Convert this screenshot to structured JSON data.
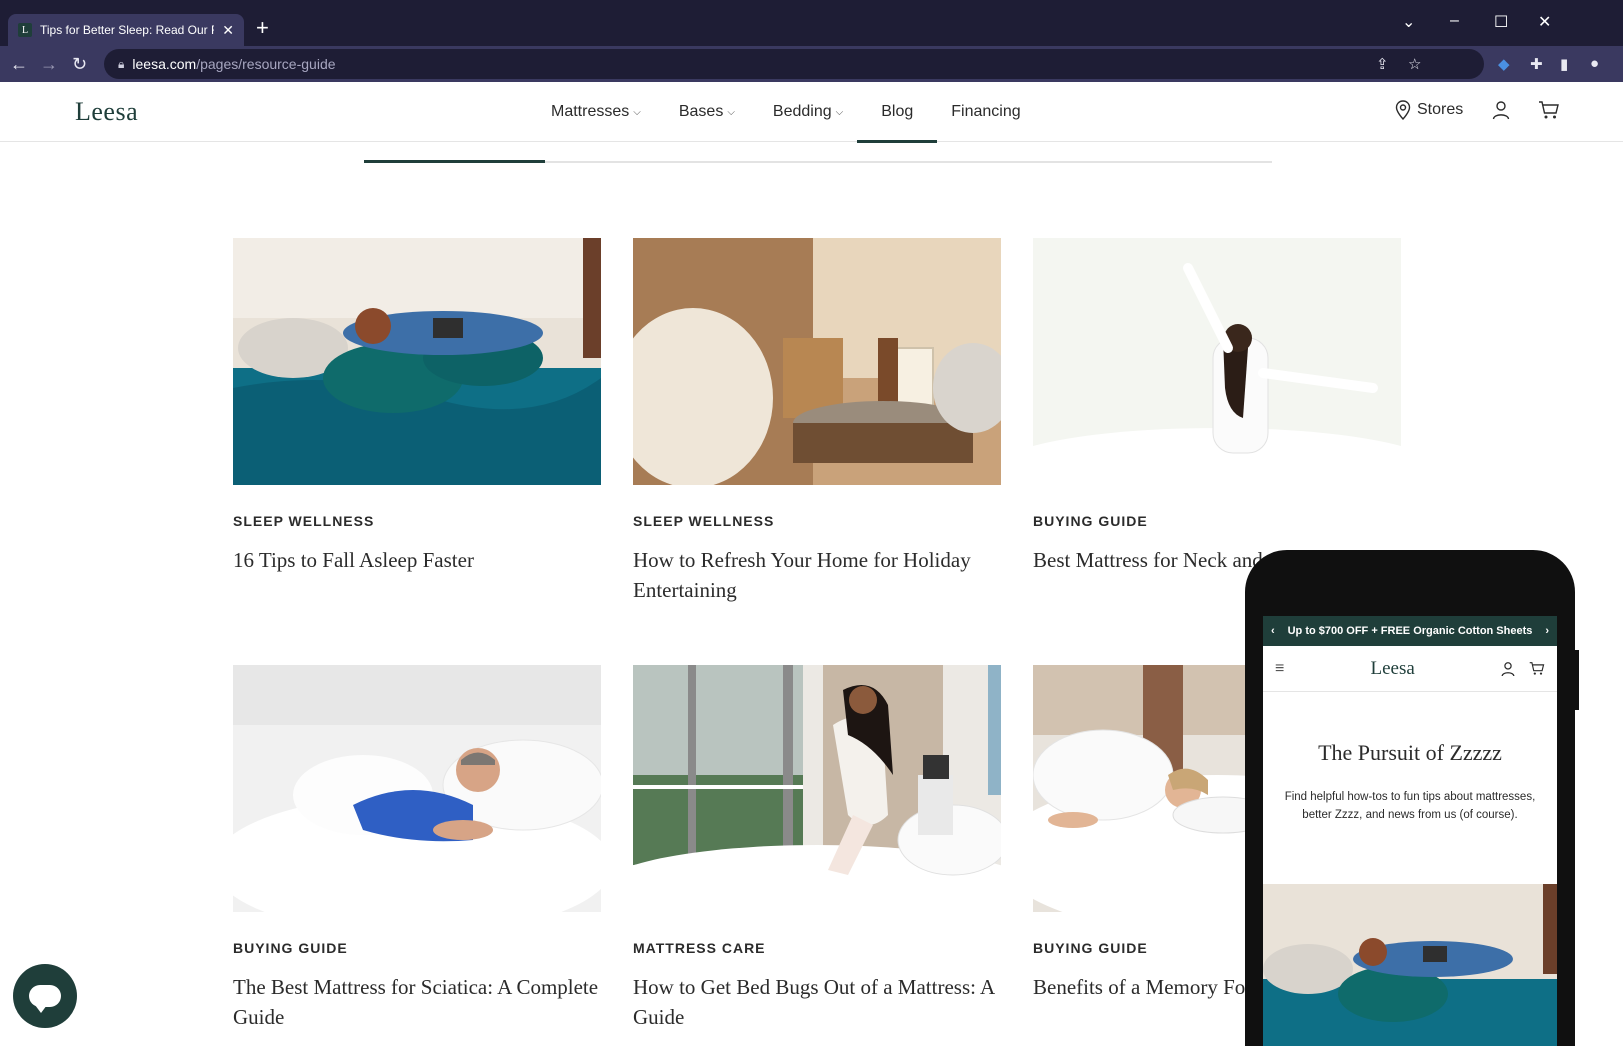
{
  "browser": {
    "tab_title": "Tips for Better Sleep: Read Our R",
    "tab_favicon": "L",
    "url_host": "leesa.com",
    "url_path": "/pages/resource-guide"
  },
  "header": {
    "logo": "Leesa",
    "nav": [
      {
        "label": "Mattresses",
        "has_menu": true
      },
      {
        "label": "Bases",
        "has_menu": true
      },
      {
        "label": "Bedding",
        "has_menu": true
      },
      {
        "label": "Blog",
        "has_menu": false,
        "active": true
      },
      {
        "label": "Financing",
        "has_menu": false
      }
    ],
    "stores_label": "Stores"
  },
  "articles": [
    {
      "category": "SLEEP WELLNESS",
      "title": "16 Tips to Fall Asleep Faster",
      "image": "woman-reading-in-bed"
    },
    {
      "category": "SLEEP WELLNESS",
      "title": "How to Refresh Your Home for Holiday Entertaining",
      "image": "candle-on-bedside-table"
    },
    {
      "category": "BUYING GUIDE",
      "title": "Best Mattress for Neck and Shoulder Pain",
      "image": "woman-stretching-on-bed"
    },
    {
      "category": "BUYING GUIDE",
      "title": "The Best Mattress for Sciatica: A Complete Guide",
      "image": "man-sleeping-on-pillow"
    },
    {
      "category": "MATTRESS CARE",
      "title": "How to Get Bed Bugs Out of a Mattress: A Guide",
      "image": "woman-making-bed"
    },
    {
      "category": "BUYING GUIDE",
      "title": "Benefits of a Memory Foam Mattress",
      "image": "woman-lying-in-bed"
    }
  ],
  "mobile": {
    "promo": "Up to $700 OFF + FREE Organic Cotton Sheets",
    "logo": "Leesa",
    "hero_title": "The Pursuit of Zzzzz",
    "hero_text": "Find helpful how-tos to fun tips about mattresses, better Zzzz, and news from us (of course)."
  },
  "colors": {
    "brand": "#1f3e3a",
    "browser_dark": "#1e1d35",
    "browser_toolbar": "#3a3960",
    "teal_bedding": "#0e6f86"
  }
}
